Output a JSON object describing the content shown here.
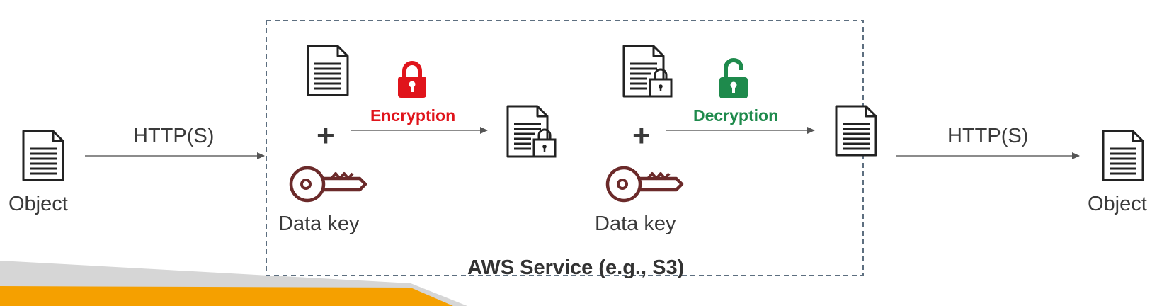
{
  "left": {
    "object_label": "Object",
    "transport_label": "HTTP(S)"
  },
  "right": {
    "object_label": "Object",
    "transport_label": "HTTP(S)"
  },
  "service_box": {
    "title": "AWS Service (e.g., S3)"
  },
  "encrypt": {
    "label": "Encryption",
    "key_label": "Data key",
    "color": "#e0141b"
  },
  "decrypt": {
    "label": "Decryption",
    "key_label": "Data key",
    "color": "#1e8a4c"
  },
  "colors": {
    "key": "#6b2a2a",
    "arrow": "#555555",
    "box_border": "#5d6f80",
    "accent_orange": "#f5a000",
    "accent_gray": "#d6d6d6"
  },
  "icons": {
    "document": "document-icon",
    "locked_document": "locked-document-icon",
    "padlock_closed": "padlock-closed-icon",
    "padlock_open": "padlock-open-icon",
    "key": "key-icon"
  }
}
